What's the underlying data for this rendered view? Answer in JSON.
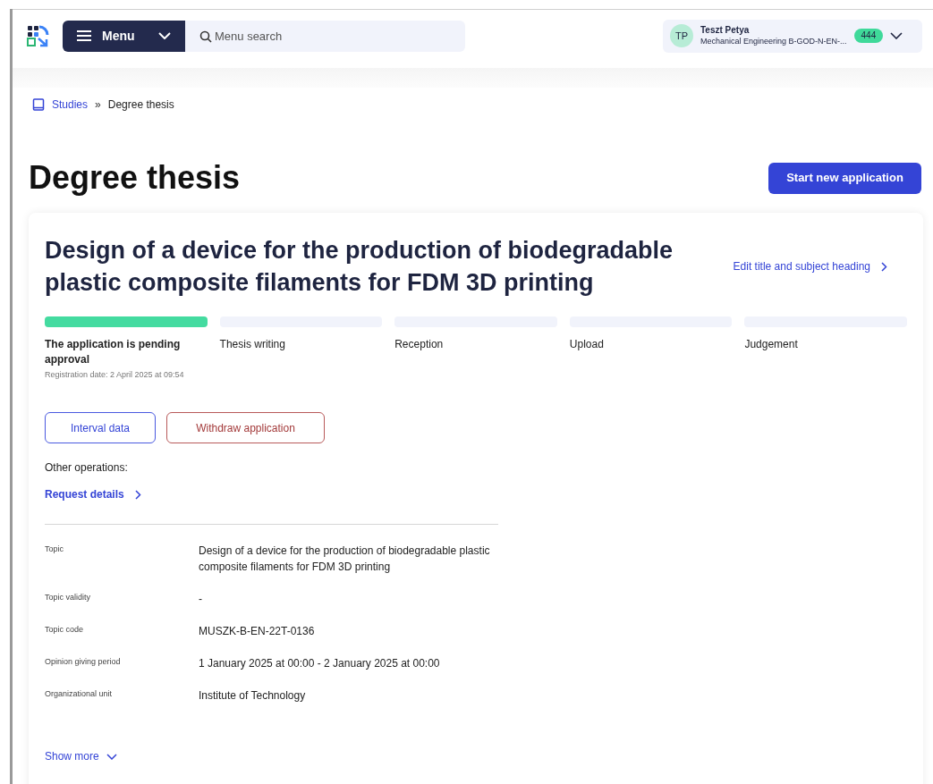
{
  "header": {
    "menu_button": "Menu",
    "search": {
      "placeholder": "Menu search"
    },
    "user": {
      "initials": "TP",
      "name": "Teszt Petya",
      "program": "Mechanical Engineering B-GOD-N-EN-...",
      "badge": "444"
    }
  },
  "breadcrumb": [
    {
      "label": "Studies",
      "link": true
    },
    {
      "label": "Degree thesis",
      "link": false
    }
  ],
  "breadcrumb_separator": "»",
  "page_title": "Degree thesis",
  "primary_button": "Start new application",
  "thesis": {
    "title": "Design of a device for the production of biodegradable plastic composite filaments for FDM 3D printing",
    "edit_link": "Edit title and subject heading",
    "steps": [
      {
        "label": "The application is pending approval",
        "completed": true,
        "note": "Registration date: 2 April 2025 at 09:54"
      },
      {
        "label": "Thesis writing",
        "completed": false
      },
      {
        "label": "Reception",
        "completed": false
      },
      {
        "label": "Upload",
        "completed": false
      },
      {
        "label": "Judgement",
        "completed": false
      }
    ],
    "buttons": [
      {
        "label": "Interval data",
        "kind": "secondary"
      },
      {
        "label": "Withdraw application",
        "kind": "danger"
      }
    ],
    "other_operations_label": "Other operations:",
    "request_details_link": "Request details",
    "details": [
      {
        "label": "Topic",
        "value": "Design of a device for the production of biodegradable plastic composite filaments for FDM 3D printing"
      },
      {
        "label": "Topic validity",
        "value": "-"
      },
      {
        "label": "Topic code",
        "value": "MUSZK-B-EN-22T-0136"
      },
      {
        "label": "Opinion giving period",
        "value": "1 January 2025 at 00:00 - 2 January 2025 at 00:00"
      },
      {
        "label": "Organizational unit",
        "value": "Institute of Technology"
      }
    ],
    "show_more_link": "Show more"
  }
}
